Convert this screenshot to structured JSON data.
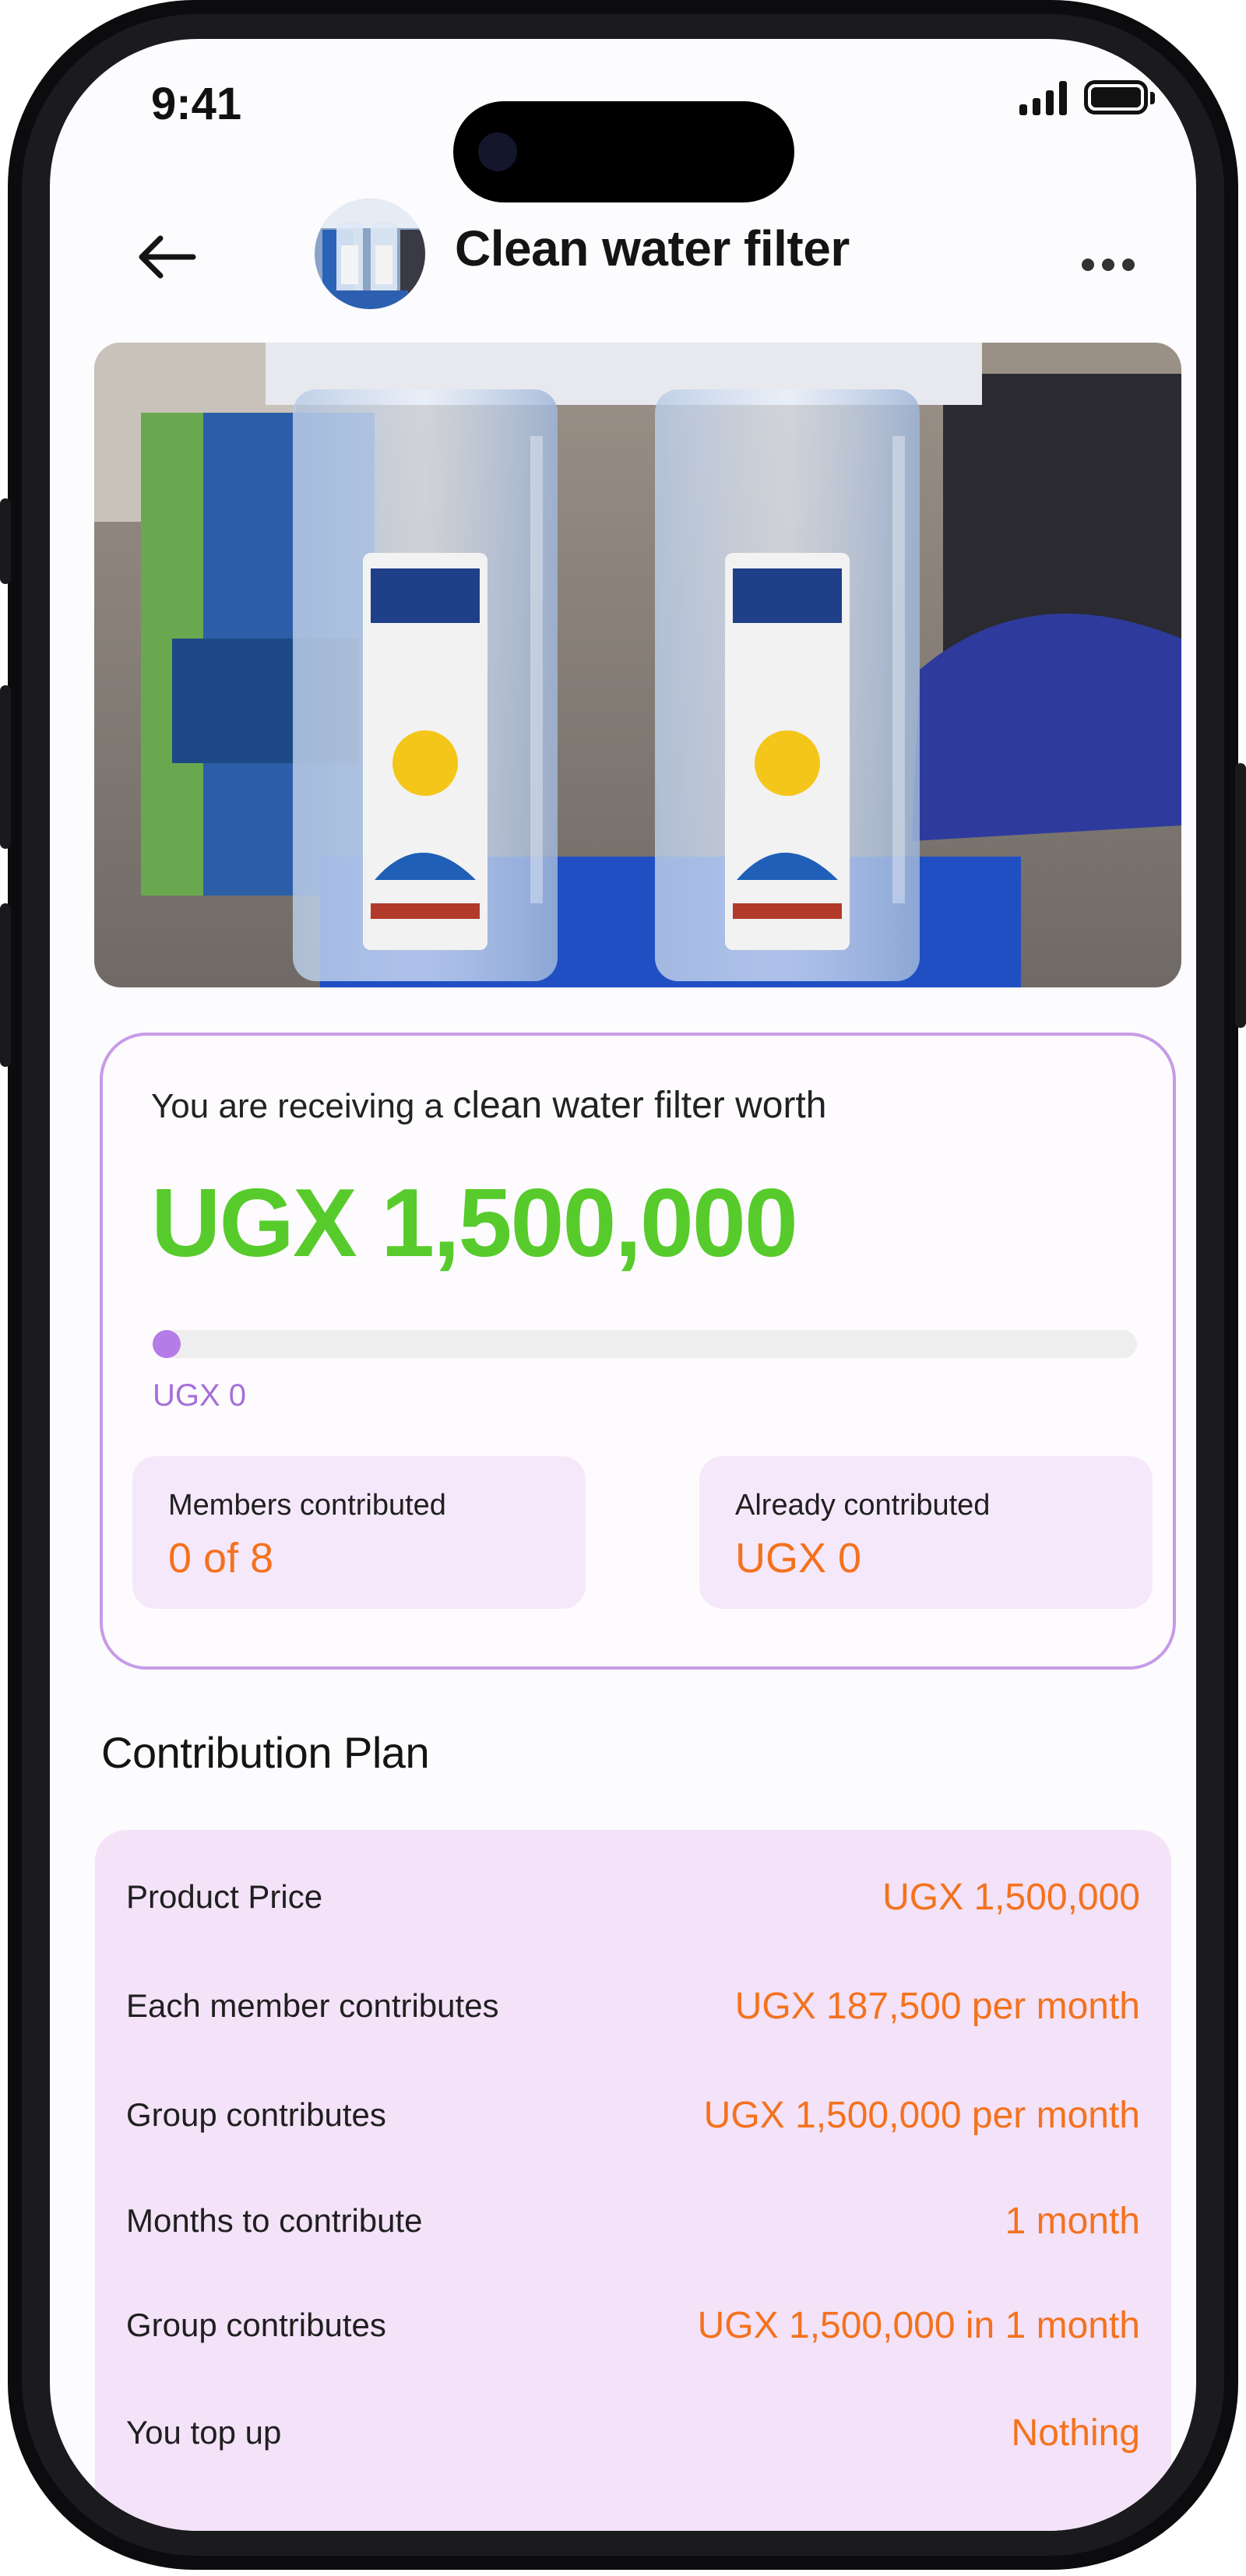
{
  "status_bar": {
    "time": "9:41"
  },
  "header": {
    "title": "Clean water filter"
  },
  "summary": {
    "receiving_prefix": "You are receiving a",
    "receiving_item": "clean water filter worth",
    "worth": "UGX 1,500,000",
    "progress_fraction": 0,
    "progress_label": "UGX 0",
    "members_label": "Members contributed",
    "members_value": "0 of 8",
    "already_label": "Already contributed",
    "already_value": "UGX 0"
  },
  "plan": {
    "heading": "Contribution Plan",
    "rows": [
      {
        "label": "Product Price",
        "value": "UGX 1,500,000"
      },
      {
        "label": "Each member contributes",
        "value": "UGX 187,500 per month"
      },
      {
        "label": "Group contributes",
        "value": "UGX 1,500,000 per month"
      },
      {
        "label": "Months to contribute",
        "value": "1 month"
      },
      {
        "label": "Group contributes",
        "value": "UGX 1,500,000 in 1 month"
      },
      {
        "label": "You top up",
        "value": "Nothing"
      }
    ]
  },
  "colors": {
    "accent_green": "#57cb2b",
    "accent_orange": "#f4721e",
    "accent_purple": "#b57be6",
    "card_tint": "#f3e2f8"
  },
  "icons": {
    "back": "arrow-left-icon",
    "more": "more-horizontal-icon"
  }
}
